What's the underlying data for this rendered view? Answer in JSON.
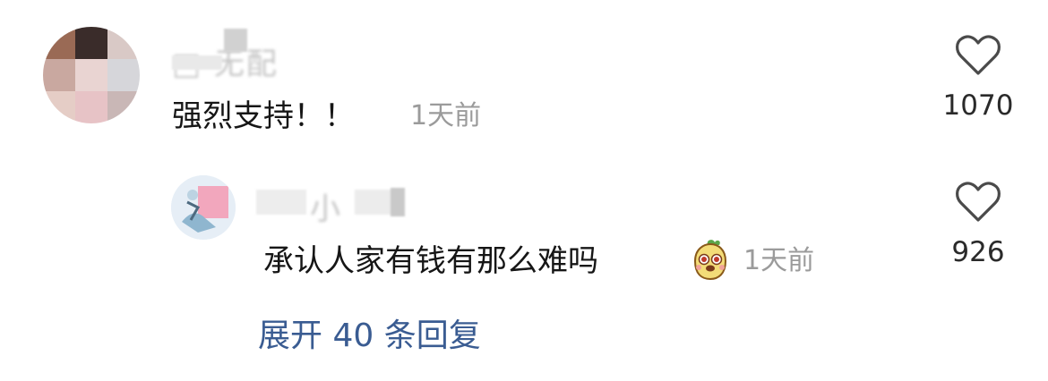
{
  "comments": [
    {
      "text": "强烈支持！！",
      "time": "1天前",
      "like_count": "1070",
      "username_hint": "□ 无配"
    },
    {
      "text": "承认人家有钱有那么难吗",
      "time": "1天前",
      "like_count": "926",
      "username_hint": "小",
      "emoji": "emoji-face-icon"
    }
  ],
  "expand_replies": "展开 40 条回复",
  "colors": {
    "text": "#161616",
    "muted": "#9b9b9b",
    "link": "#3a5c92",
    "icon": "#4a4a4a"
  }
}
